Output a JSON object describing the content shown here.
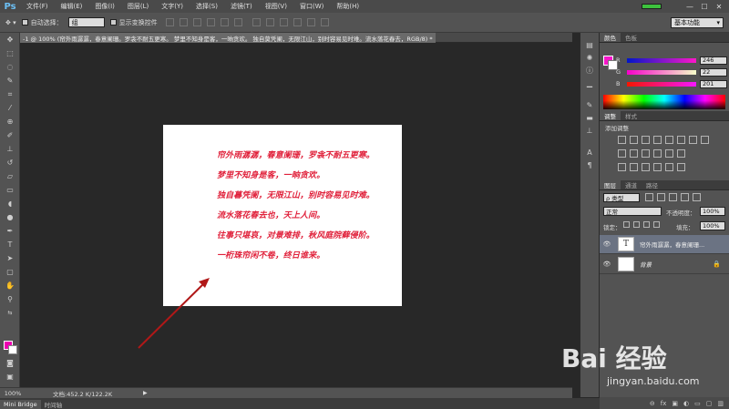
{
  "app": {
    "logo": "Ps"
  },
  "menu": [
    "文件(F)",
    "编辑(E)",
    "图像(I)",
    "图层(L)",
    "文字(Y)",
    "选择(S)",
    "滤镜(T)",
    "视图(V)",
    "窗口(W)",
    "帮助(H)"
  ],
  "window_controls": {
    "minimize": "—",
    "maximize": "☐",
    "close": "✕"
  },
  "progress": 1.0,
  "options": {
    "auto_select_label": "自动选择：",
    "auto_select_value": "组",
    "show_transform_label": "显示变换控件",
    "workspace": "基本功能"
  },
  "document_tab": "-1 @ 100% (帘外雨潺潺，春意阑珊。罗衾不耐五更寒。  梦里不知身是客，一晌贪欢。  独自莫凭阑，无限江山，别时容易见时难。流水落花春去，RGB/8) *",
  "poem": [
    "帘外雨潺潺，春意阑珊，罗衾不耐五更寒。",
    "梦里不知身是客，一晌贪欢。",
    "独自暮凭阑，无限江山，别时容易见时难。",
    "流水落花春去也，天上人间。",
    "往事只堪哀，对景难排，秋风庭院藓侵阶。",
    "一桁珠帘闲不卷，终日谁来。"
  ],
  "status": {
    "zoom": "100%",
    "doc_info": "文档:452.2 K/122.2K",
    "play": "▶"
  },
  "bottom_tabs": [
    "Mini Bridge",
    "时间轴"
  ],
  "color_panel": {
    "tabs": [
      "颜色",
      "色板"
    ],
    "r_label": "R",
    "g_label": "G",
    "b_label": "B",
    "r": "246",
    "g": "22",
    "b": "201",
    "fg_color": "#f616c9"
  },
  "adjust_panel": {
    "tabs": [
      "调整",
      "样式"
    ],
    "title": "添加调整"
  },
  "layers_panel": {
    "tabs": [
      "图层",
      "通道",
      "路径"
    ],
    "filter": "ρ 类型",
    "blend_mode": "正常",
    "opacity_label": "不透明度：",
    "opacity": "100%",
    "lock_label": "锁定：",
    "fill_label": "填充：",
    "fill": "100%",
    "layers": [
      {
        "name": "帘外雨潺潺，春意阑珊...",
        "thumb": "T"
      },
      {
        "name": "背景",
        "thumb": ""
      }
    ]
  },
  "watermark": {
    "brand": "Bai 经验",
    "url": "jingyan.baidu.com"
  }
}
